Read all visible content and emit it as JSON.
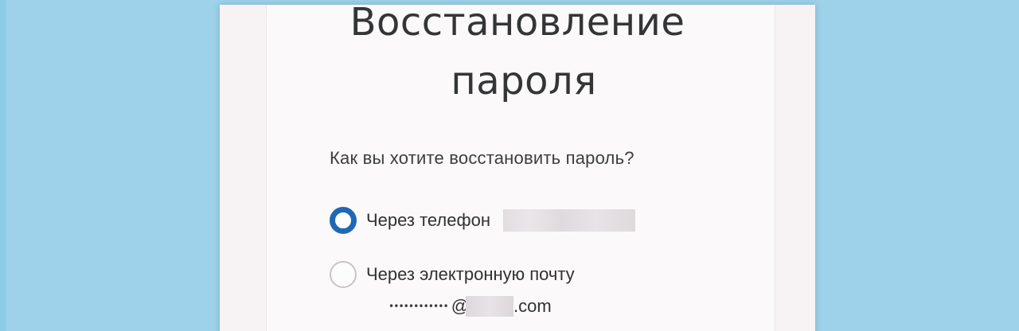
{
  "page": {
    "title_line1": "Восстановление",
    "title_line2": "пароля",
    "question": "Как вы хотите восстановить пароль?"
  },
  "options": [
    {
      "label": "Через телефон",
      "selected": true
    },
    {
      "label": "Через электронную почту",
      "selected": false
    }
  ],
  "email": {
    "masked_local": "••••••••••••",
    "at": "@",
    "suffix": ".com"
  },
  "colors": {
    "background": "#9dd2ea",
    "accent": "#1f68b6",
    "text": "#333536"
  }
}
